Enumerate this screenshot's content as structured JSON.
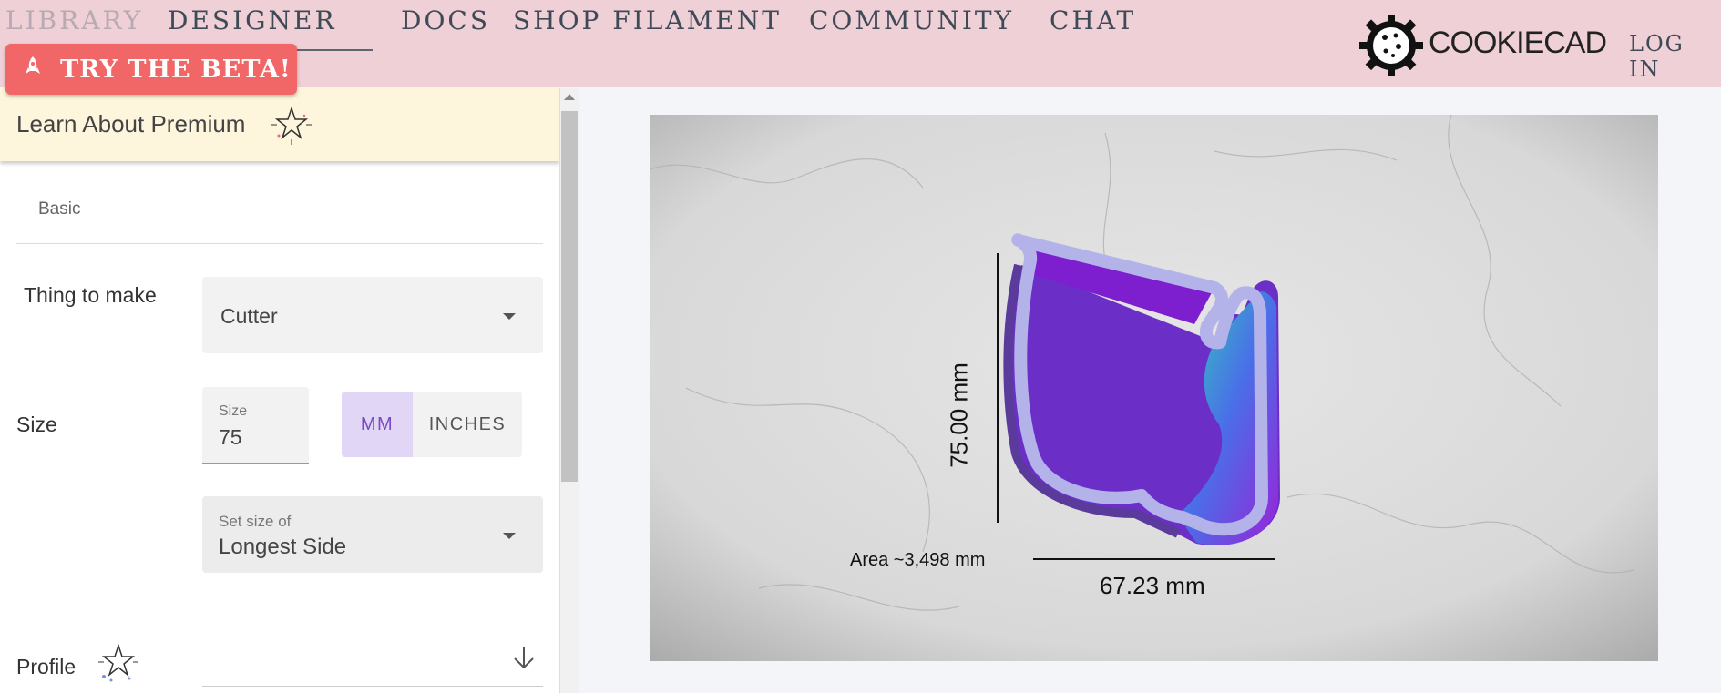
{
  "nav": {
    "library": "LIBRARY",
    "designer": "DESIGNER",
    "docs": "DOCS",
    "shop": "SHOP FILAMENT",
    "community": "COMMUNITY",
    "chat": "CHAT",
    "logo_text": "COOKIECAD",
    "login": "LOG IN"
  },
  "beta": {
    "label": "TRY THE BETA!",
    "icon": "rocket-icon"
  },
  "premium": {
    "label": "Learn About Premium",
    "icon": "sparkle-star-icon"
  },
  "tabs": {
    "basic": "Basic"
  },
  "form": {
    "thing_label": "Thing to make",
    "thing_value": "Cutter",
    "size_label": "Size",
    "size_field_label": "Size",
    "size_value": "75",
    "unit_mm": "MM",
    "unit_inches": "INCHES",
    "unit_selected": "MM",
    "setsize_label": "Set size of",
    "setsize_value": "Longest Side",
    "profile_label": "Profile"
  },
  "preview": {
    "area": "Area ~3,498 mm",
    "width": "67.23 mm",
    "height": "75.00 mm"
  },
  "colors": {
    "nav_bg": "#eed0d6",
    "beta_bg": "#f16767",
    "premium_bg": "#fdf6dc",
    "unit_selected_bg": "#e2d6f6",
    "unit_selected_text": "#7a48c7",
    "cutter_outline": "#b3b3ea"
  }
}
